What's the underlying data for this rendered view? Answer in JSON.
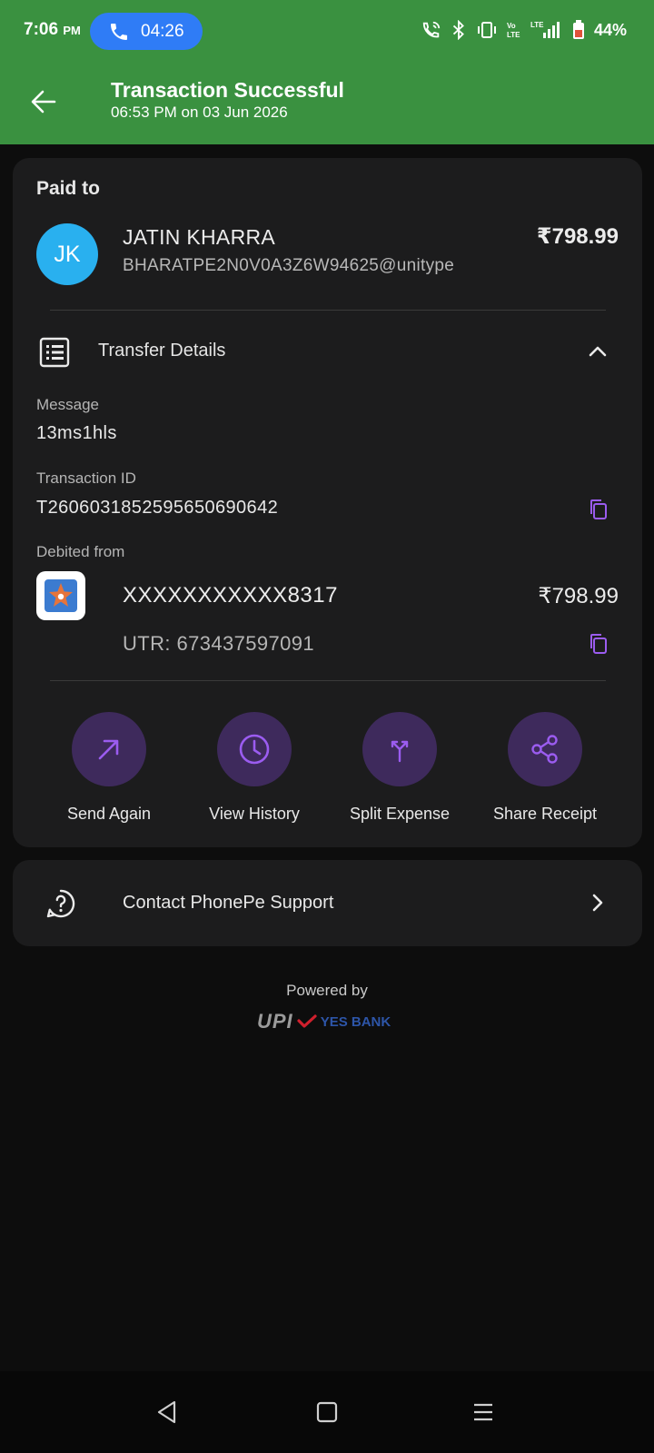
{
  "status_bar": {
    "time": "7:06",
    "ampm": "PM",
    "call_timer": "04:26",
    "battery": "44%"
  },
  "header": {
    "title": "Transaction Successful",
    "subtitle": "06:53 PM on 03 Jun 2026",
    "background": "#3a9140"
  },
  "payee": {
    "section_label": "Paid to",
    "initials": "JK",
    "name": "JATIN KHARRA",
    "vpa": "BHARATPE2N0V0A3Z6W94625@unitype",
    "amount": "₹798.99"
  },
  "transfer_details": {
    "label": "Transfer Details",
    "message_label": "Message",
    "message_value": "13ms1hls",
    "txn_id_label": "Transaction ID",
    "txn_id_value": "T2606031852595650690642",
    "debited_label": "Debited from",
    "account": "XXXXXXXXXXX8317",
    "account_amount": "₹798.99",
    "utr": "UTR: 673437597091"
  },
  "actions": [
    {
      "label": "Send Again",
      "icon": "arrow-up-right-icon"
    },
    {
      "label": "View History",
      "icon": "clock-icon"
    },
    {
      "label": "Split Expense",
      "icon": "split-icon"
    },
    {
      "label": "Share Receipt",
      "icon": "share-icon"
    }
  ],
  "support": {
    "label": "Contact PhonePe Support"
  },
  "footer": {
    "powered_by": "Powered by",
    "upi": "UPI",
    "bank": "YES BANK"
  },
  "colors": {
    "accent_purple": "#9b5cf0",
    "action_circle": "#3e2a5c",
    "avatar": "#29b0ef"
  }
}
